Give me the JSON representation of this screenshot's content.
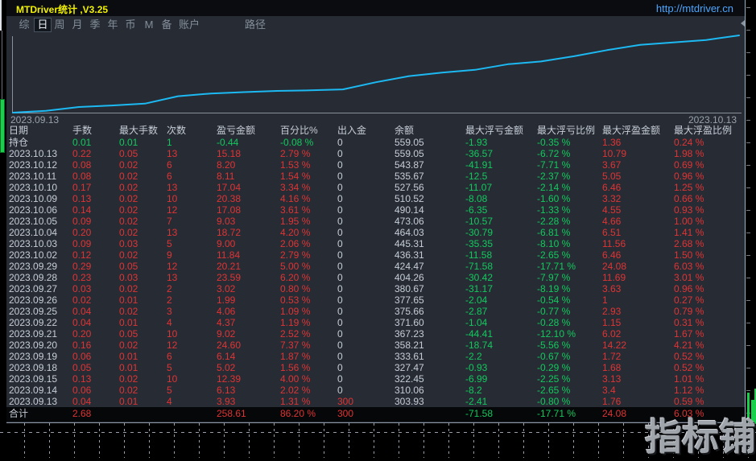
{
  "window": {
    "title": "MTDriver统计 ,V3.25",
    "url": "http://mtdriver.cn"
  },
  "menu": {
    "items": [
      "综",
      "日",
      "周",
      "月",
      "季",
      "年",
      "币",
      "M",
      "备",
      "账户"
    ],
    "selected_index": 1,
    "path_label": "路径"
  },
  "chart": {
    "start_date_label": "2023.09.13",
    "end_date_label": "2023.10.13"
  },
  "chart_data": {
    "type": "line",
    "x": [
      "2023.09.13",
      "2023.09.14",
      "2023.09.15",
      "2023.09.18",
      "2023.09.19",
      "2023.09.20",
      "2023.09.21",
      "2023.09.22",
      "2023.09.25",
      "2023.09.26",
      "2023.09.27",
      "2023.09.28",
      "2023.09.29",
      "2023.10.02",
      "2023.10.03",
      "2023.10.04",
      "2023.10.05",
      "2023.10.06",
      "2023.10.09",
      "2023.10.10",
      "2023.10.11",
      "2023.10.12",
      "2023.10.13"
    ],
    "series": [
      {
        "name": "余额",
        "values": [
          303.93,
          310.06,
          322.45,
          327.47,
          333.61,
          358.21,
          367.23,
          371.6,
          375.66,
          377.65,
          380.67,
          404.26,
          424.47,
          436.31,
          445.31,
          464.03,
          473.06,
          490.14,
          510.52,
          527.56,
          535.67,
          543.87,
          559.05
        ]
      }
    ],
    "xlabel": "",
    "ylabel": "",
    "ylim": [
      300,
      565
    ],
    "grid": false,
    "line_color": "#1cb9f3",
    "x_tick_labels_shown": [
      "2023.09.13",
      "2023.10.13"
    ],
    "legend": "none"
  },
  "table": {
    "columns": [
      "日期",
      "手数",
      "最大手数",
      "次数",
      "盈亏金额",
      "百分比%",
      "出入金",
      "余额",
      "最大浮亏金额",
      "最大浮亏比例",
      "最大浮盈金额",
      "最大浮盈比例"
    ],
    "position_row": [
      "持仓",
      "0.01",
      "0.01",
      "1",
      "-0.44",
      "-0.08 %",
      "0",
      "559.05",
      "-1.93",
      "-0.35 %",
      "1.36",
      "0.24 %"
    ],
    "rows": [
      [
        "2023.10.13",
        "0.22",
        "0.05",
        "13",
        "15.18",
        "2.79 %",
        "0",
        "559.05",
        "-36.57",
        "-6.72 %",
        "10.79",
        "1.98 %"
      ],
      [
        "2023.10.12",
        "0.08",
        "0.02",
        "6",
        "8.20",
        "1.53 %",
        "0",
        "543.87",
        "-41.91",
        "-7.71 %",
        "3.67",
        "0.69 %"
      ],
      [
        "2023.10.11",
        "0.08",
        "0.02",
        "6",
        "8.11",
        "1.54 %",
        "0",
        "535.67",
        "-12.5",
        "-2.37 %",
        "5.05",
        "0.96 %"
      ],
      [
        "2023.10.10",
        "0.17",
        "0.02",
        "13",
        "17.04",
        "3.34 %",
        "0",
        "527.56",
        "-11.07",
        "-2.14 %",
        "6.46",
        "1.25 %"
      ],
      [
        "2023.10.09",
        "0.13",
        "0.02",
        "10",
        "20.38",
        "4.16 %",
        "0",
        "510.52",
        "-8.08",
        "-1.60 %",
        "3.32",
        "0.66 %"
      ],
      [
        "2023.10.06",
        "0.14",
        "0.02",
        "12",
        "17.08",
        "3.61 %",
        "0",
        "490.14",
        "-6.35",
        "-1.33 %",
        "4.55",
        "0.93 %"
      ],
      [
        "2023.10.05",
        "0.09",
        "0.02",
        "7",
        "9.03",
        "1.95 %",
        "0",
        "473.06",
        "-10.57",
        "-2.28 %",
        "4.66",
        "1.00 %"
      ],
      [
        "2023.10.04",
        "0.20",
        "0.02",
        "13",
        "18.72",
        "4.20 %",
        "0",
        "464.03",
        "-30.79",
        "-6.81 %",
        "6.51",
        "1.41 %"
      ],
      [
        "2023.10.03",
        "0.09",
        "0.03",
        "5",
        "9.00",
        "2.06 %",
        "0",
        "445.31",
        "-35.35",
        "-8.10 %",
        "11.56",
        "2.68 %"
      ],
      [
        "2023.10.02",
        "0.12",
        "0.02",
        "9",
        "11.84",
        "2.79 %",
        "0",
        "436.31",
        "-11.58",
        "-2.65 %",
        "6.46",
        "1.50 %"
      ],
      [
        "2023.09.29",
        "0.29",
        "0.05",
        "12",
        "20.21",
        "5.00 %",
        "0",
        "424.47",
        "-71.58",
        "-17.71 %",
        "24.08",
        "6.03 %"
      ],
      [
        "2023.09.28",
        "0.23",
        "0.03",
        "13",
        "23.59",
        "6.20 %",
        "0",
        "404.26",
        "-30.42",
        "-7.97 %",
        "11.69",
        "3.01 %"
      ],
      [
        "2023.09.27",
        "0.03",
        "0.02",
        "2",
        "3.02",
        "0.80 %",
        "0",
        "380.67",
        "-31.17",
        "-8.19 %",
        "3.63",
        "0.96 %"
      ],
      [
        "2023.09.26",
        "0.02",
        "0.01",
        "2",
        "1.99",
        "0.53 %",
        "0",
        "377.65",
        "-2.04",
        "-0.54 %",
        "1",
        "0.27 %"
      ],
      [
        "2023.09.25",
        "0.04",
        "0.02",
        "3",
        "4.06",
        "1.09 %",
        "0",
        "375.66",
        "-2.87",
        "-0.77 %",
        "2.93",
        "0.79 %"
      ],
      [
        "2023.09.22",
        "0.04",
        "0.01",
        "4",
        "4.37",
        "1.19 %",
        "0",
        "371.60",
        "-1.04",
        "-0.28 %",
        "1.15",
        "0.31 %"
      ],
      [
        "2023.09.21",
        "0.20",
        "0.05",
        "10",
        "9.02",
        "2.52 %",
        "0",
        "367.23",
        "-44.41",
        "-12.10 %",
        "6.02",
        "1.67 %"
      ],
      [
        "2023.09.20",
        "0.16",
        "0.02",
        "12",
        "24.60",
        "7.37 %",
        "0",
        "358.21",
        "-18.74",
        "-5.56 %",
        "14.22",
        "4.21 %"
      ],
      [
        "2023.09.19",
        "0.06",
        "0.01",
        "6",
        "6.14",
        "1.87 %",
        "0",
        "333.61",
        "-2.2",
        "-0.67 %",
        "1.72",
        "0.52 %"
      ],
      [
        "2023.09.18",
        "0.05",
        "0.01",
        "5",
        "5.02",
        "1.56 %",
        "0",
        "327.47",
        "-0.93",
        "-0.29 %",
        "1.68",
        "0.52 %"
      ],
      [
        "2023.09.15",
        "0.13",
        "0.02",
        "10",
        "12.39",
        "4.00 %",
        "0",
        "322.45",
        "-6.99",
        "-2.25 %",
        "3.13",
        "1.01 %"
      ],
      [
        "2023.09.14",
        "0.06",
        "0.02",
        "5",
        "6.13",
        "2.02 %",
        "0",
        "310.06",
        "-8.2",
        "-2.65 %",
        "3.4",
        "1.12 %"
      ],
      [
        "2023.09.13",
        "0.04",
        "0.01",
        "4",
        "3.93",
        "1.31 %",
        "300",
        "303.93",
        "-2.41",
        "-0.80 %",
        "1.76",
        "0.59 %"
      ]
    ],
    "total_row": [
      "合计",
      "2.68",
      "",
      "",
      "258.61",
      "86.20 %",
      "300",
      "",
      "-71.58",
      "-17.71 %",
      "24.08",
      "6.03 %"
    ]
  },
  "watermark": "指标铺",
  "colors": {
    "panel_bg": "#272c34",
    "titlebar_bg": "#0b0c0f",
    "title_yellow": "#f2f200",
    "url_blue": "#4da6ff",
    "profit_red": "#df3434",
    "loss_green": "#12c95e",
    "neutral_gray": "#c7cdd7",
    "equity_line_blue": "#1cb9f3"
  }
}
